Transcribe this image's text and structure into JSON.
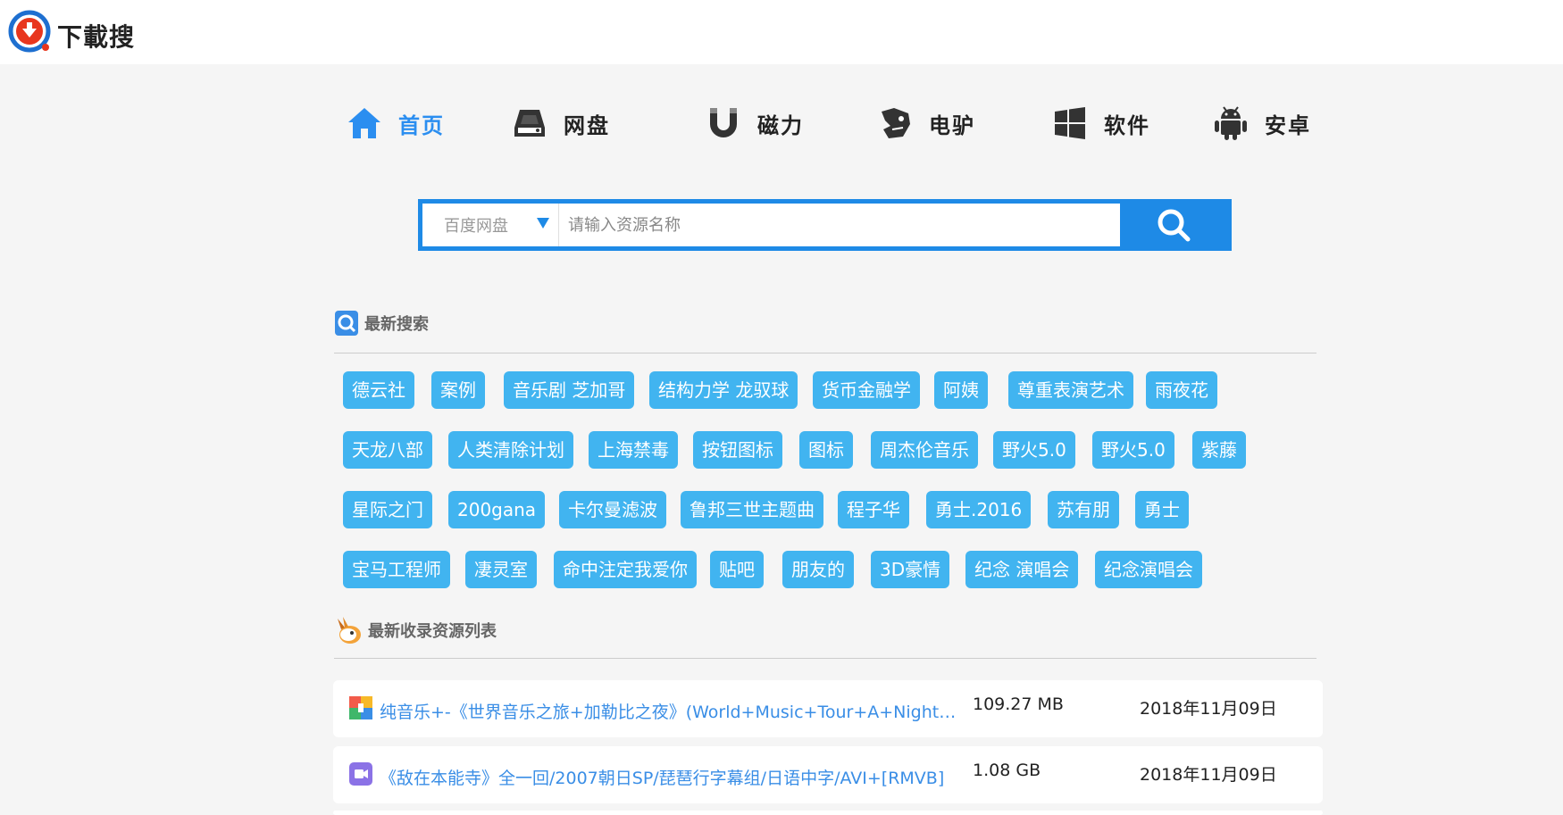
{
  "header": {
    "logo_text": "下載搜"
  },
  "nav": [
    {
      "label": "首页",
      "icon": "home-icon",
      "active": true
    },
    {
      "label": "网盘",
      "icon": "disk-icon",
      "active": false
    },
    {
      "label": "磁力",
      "icon": "magnet-icon",
      "active": false
    },
    {
      "label": "电驴",
      "icon": "donkey-icon",
      "active": false
    },
    {
      "label": "软件",
      "icon": "windows-icon",
      "active": false
    },
    {
      "label": "安卓",
      "icon": "android-icon",
      "active": false
    }
  ],
  "search": {
    "source_selected": "百度网盘",
    "placeholder": "请输入资源名称",
    "value": ""
  },
  "latest_searches": {
    "title": "最新搜索",
    "tags": [
      "德云社",
      "案例",
      "音乐剧 芝加哥",
      "结构力学 龙驭球",
      "货币金融学",
      "阿姨",
      "尊重表演艺术",
      "雨夜花",
      "天龙八部",
      "人类清除计划",
      "上海禁毒",
      "按钮图标",
      "图标",
      "周杰伦音乐",
      "野火5.0",
      "野火5.0",
      "紫藤",
      "星际之门",
      "200gana",
      "卡尔曼滤波",
      "鲁邦三世主题曲",
      "程子华",
      "勇士.2016",
      "苏有朋",
      "勇士",
      "宝马工程师",
      "凄灵室",
      "命中注定我爱你",
      "贴吧",
      "朋友的",
      "3D豪情",
      "纪念 演唱会",
      "纪念演唱会"
    ]
  },
  "latest_resources": {
    "title": "最新收录资源列表",
    "items": [
      {
        "name": "纯音乐+-《世界音乐之旅+加勒比之夜》(World+Music+Tour+A+Night+O...",
        "size": "109.27 MB",
        "date": "2018年11月09日",
        "icon": "archive-icon"
      },
      {
        "name": "《敌在本能寺》全一回/2007朝日SP/琵琶行字幕组/日语中字/AVI+[RMVB]",
        "size": "1.08 GB",
        "date": "2018年11月09日",
        "icon": "video-icon"
      }
    ]
  },
  "colors": {
    "accent": "#1e8ae6",
    "tag_bg": "#41b4f0",
    "link": "#3a8ee6",
    "page_bg": "#f5f5f5"
  }
}
